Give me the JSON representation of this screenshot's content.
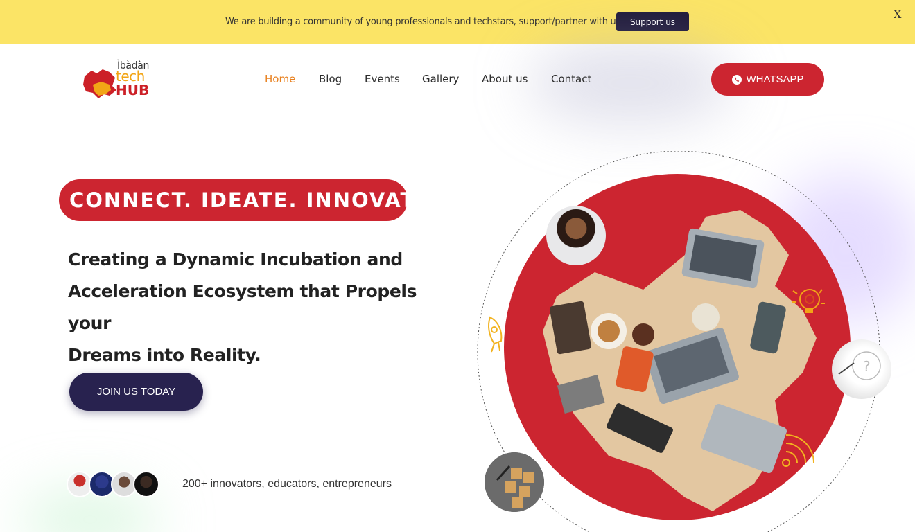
{
  "announcement": {
    "text": "We are building a community of young professionals and techstars, support/partner with us.",
    "button_label": "Support us",
    "close_label": "X"
  },
  "logo": {
    "line1": "Ìbàdàn",
    "line2": "tech",
    "line3": "HUB"
  },
  "nav": {
    "items": [
      {
        "label": "Home",
        "active": true
      },
      {
        "label": "Blog"
      },
      {
        "label": "Events"
      },
      {
        "label": "Gallery"
      },
      {
        "label": "About us"
      },
      {
        "label": "Contact"
      }
    ],
    "whatsapp_label": "WHATSAPP",
    "whatsapp_icon": "whatsapp-icon"
  },
  "hero": {
    "tagline": "CONNECT. IDEATE. INNOVATE.",
    "headline_line1": "Creating a Dynamic Incubation and",
    "headline_line2": "Acceleration Ecosystem that Propels your",
    "headline_line3": "Dreams into Reality.",
    "cta_label": "JOIN US TODAY",
    "community_text": "200+ innovators, educators, entrepreneurs"
  },
  "colors": {
    "announcement_bg": "#fbe466",
    "brand_red": "#cc2530",
    "brand_orange": "#e8801e",
    "brand_navy": "#28224f"
  },
  "decor_icons": [
    "rocket-icon",
    "lightbulb-gear-icon",
    "signal-icon"
  ]
}
